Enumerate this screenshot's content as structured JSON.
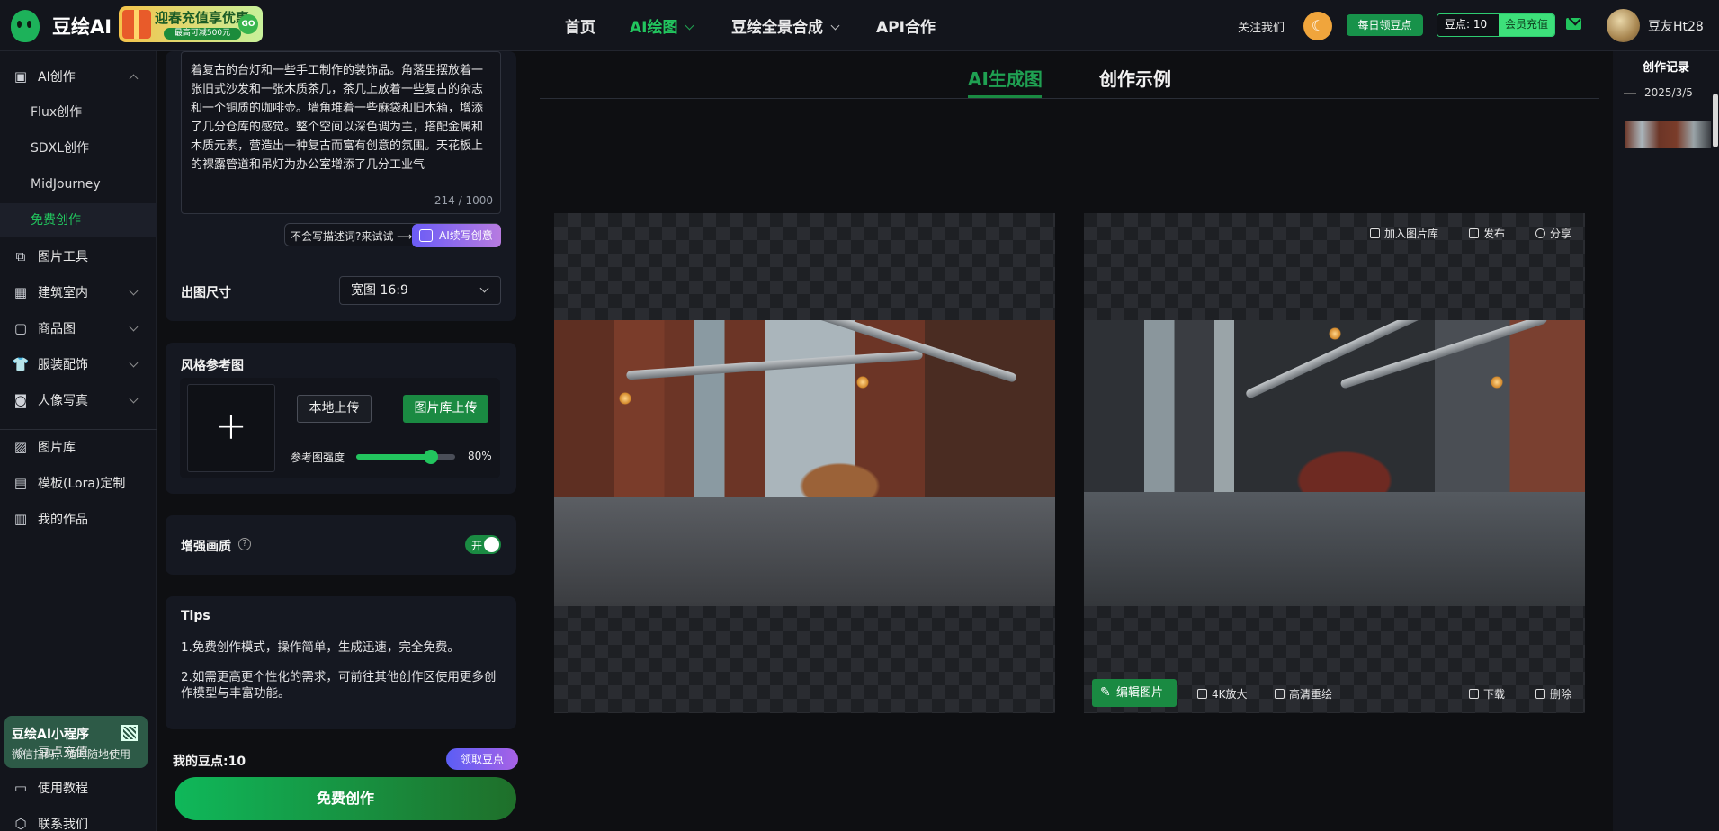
{
  "header": {
    "logo_text": "豆绘AI",
    "promo_title": "迎春充值享优惠",
    "promo_sub": "最高可减500元",
    "promo_go": "GO",
    "nav": [
      {
        "label": "首页",
        "active": false,
        "dropdown": false
      },
      {
        "label": "AI绘图",
        "active": true,
        "dropdown": true
      },
      {
        "label": "豆绘全景合成",
        "active": false,
        "dropdown": true
      },
      {
        "label": "API合作",
        "active": false,
        "dropdown": false
      }
    ],
    "follow": "关注我们",
    "daily_points": "每日领豆点",
    "points_label": "豆点: 10",
    "vip_recharge": "会员充值",
    "username": "豆友Ht28"
  },
  "sidebar": {
    "ai_create": "AI创作",
    "sub_items": [
      "Flux创作",
      "SDXL创作",
      "MidJourney",
      "免费创作"
    ],
    "active_sub": "免费创作",
    "groups": [
      "图片工具",
      "建筑室内",
      "商品图",
      "服装配饰",
      "人像写真"
    ],
    "links": [
      "图片库",
      "模板(Lora)定制",
      "我的作品"
    ],
    "mini_title": "豆绘AI小程序",
    "mini_sub": "微信扫码，随时随地使用",
    "bottom": [
      "豆点充值",
      "使用教程",
      "联系我们"
    ]
  },
  "form": {
    "prompt_text": "着复古的台灯和一些手工制作的装饰品。角落里摆放着一张旧式沙发和一张木质茶几，茶几上放着一些复古的杂志和一个铜质的咖啡壶。墙角堆着一些麻袋和旧木箱，增添了几分仓库的感觉。整个空间以深色调为主，搭配金属和木质元素，营造出一种复古而富有创意的氛围。天花板上的裸露管道和吊灯为办公室增添了几分工业气",
    "char_count": "214 / 1000",
    "hint": "不会写描述词?来试试 ⟶",
    "ai_rewrite": "AI续写创意",
    "size_label": "出图尺寸",
    "size_value": "宽图 16:9",
    "style_ref_label": "风格参考图",
    "local_upload": "本地上传",
    "library_upload": "图片库上传",
    "strength_label": "参考图强度",
    "strength_value": 0.8,
    "strength_text": "80%",
    "enhance_label": "增强画质",
    "enhance_toggle": "开",
    "tips_title": "Tips",
    "tips": [
      "1.免费创作模式，操作简单，生成迅速，完全免费。",
      "2.如需更高更个性化的需求，可前往其他创作区使用更多创作模型与丰富功能。"
    ],
    "my_points": "我的豆点:10",
    "claim_points": "领取豆点",
    "free_create": "免费创作"
  },
  "main": {
    "tabs": [
      "AI生成图",
      "创作示例"
    ],
    "active_tab": "AI生成图",
    "top_tools": [
      "加入图片库",
      "发布",
      "分享"
    ],
    "bottom_tools": {
      "edit": "编辑图片",
      "upscale": "4K放大",
      "redraw": "高清重绘",
      "download": "下载",
      "delete": "删除"
    }
  },
  "history": {
    "title": "创作记录",
    "date": "2025/3/5"
  },
  "colors": {
    "accent": "#22c55e",
    "brand_green": "#1a8a42",
    "purple": "#7b61f0",
    "bg": "#0e0f12"
  }
}
